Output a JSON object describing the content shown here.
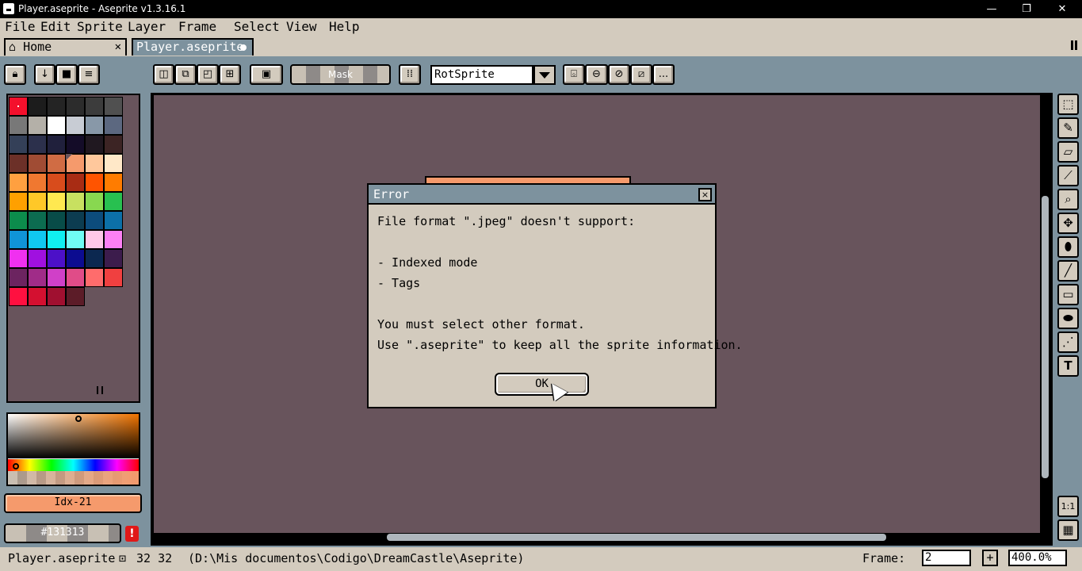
{
  "window": {
    "title": "Player.aseprite - Aseprite v1.3.16.1",
    "controls": [
      "—",
      "❐",
      "✕"
    ]
  },
  "menu": {
    "items": [
      "File",
      "Edit",
      "Sprite",
      "Layer",
      "Frame",
      "Select",
      "View",
      "Help"
    ]
  },
  "tabs": [
    {
      "label": "Home"
    },
    {
      "label": "Player.aseprite"
    }
  ],
  "toolbar": {
    "mask_label": "Mask",
    "rotation_algorithm": "RotSprite",
    "more_label": "..."
  },
  "palette": {
    "colors": [
      "#f4102c",
      "#1c1c1c",
      "#242424",
      "#2c2c2c",
      "#3c3c3c",
      "#505050",
      "#787878",
      "#b4b0a8",
      "#ffffff",
      "#c8ccd4",
      "#8898a8",
      "#5c6880",
      "#344058",
      "#2c304c",
      "#20203c",
      "#140c28",
      "#201820",
      "#3c2424",
      "#6c3028",
      "#a04c34",
      "#d06c44",
      "#f59a6c",
      "#ffc89c",
      "#ffe8c8",
      "#ffa040",
      "#f07830",
      "#d84c1c",
      "#a82c14",
      "#ff5400",
      "#ff7c00",
      "#ffa000",
      "#ffc828",
      "#ffe850",
      "#c8e060",
      "#88d850",
      "#28c050",
      "#0c8c4c",
      "#0c6c50",
      "#084c48",
      "#0c3c50",
      "#0c4c7c",
      "#0c70a8",
      "#1094d8",
      "#10c8f0",
      "#10f0f0",
      "#70fcf4",
      "#ffc8e8",
      "#fc80f4",
      "#f030f0",
      "#a010e0",
      "#4c10c8",
      "#0c0c90",
      "#0c2850",
      "#3c1c4c",
      "#6c2460",
      "#a02c88",
      "#d040c8",
      "#e04c88",
      "#ff6c6c",
      "#f04040",
      "#ff1040",
      "#d41030",
      "#a01030",
      "#5c1c28"
    ],
    "selected_index": 21
  },
  "color": {
    "foreground_label": "Idx-21",
    "foreground_hex": "#f59a6c",
    "background_label": "#131313",
    "warning_label": "!"
  },
  "dialog": {
    "title": "Error",
    "close_label": "×",
    "lines": [
      "File format \".jpeg\" doesn't support:",
      "",
      "- Indexed mode",
      "- Tags",
      "",
      "You must select other format.",
      "Use \".aseprite\" to keep all the sprite information."
    ],
    "ok_label": "OK"
  },
  "tools": [
    "rectangular-marquee",
    "pencil",
    "eraser",
    "eyedropper",
    "zoom",
    "move",
    "paint-bucket",
    "line",
    "rectangle",
    "contour",
    "blur",
    "text"
  ],
  "right_bottom": {
    "ratio_label": "1:1",
    "timeline_label": "▦"
  },
  "status": {
    "filename": "Player.aseprite",
    "size": "32 32",
    "path": "(D:\\Mis documentos\\Codigo\\DreamCastle\\Aseprite)",
    "frame_label": "Frame:",
    "frame_value": "2",
    "plus_label": "+",
    "zoom_value": "400.0%"
  },
  "colors": {
    "accent": "#7d929e",
    "panel": "#d3cbbe",
    "canvas_bg": "#68545c",
    "sprite": "#f59a6c"
  }
}
